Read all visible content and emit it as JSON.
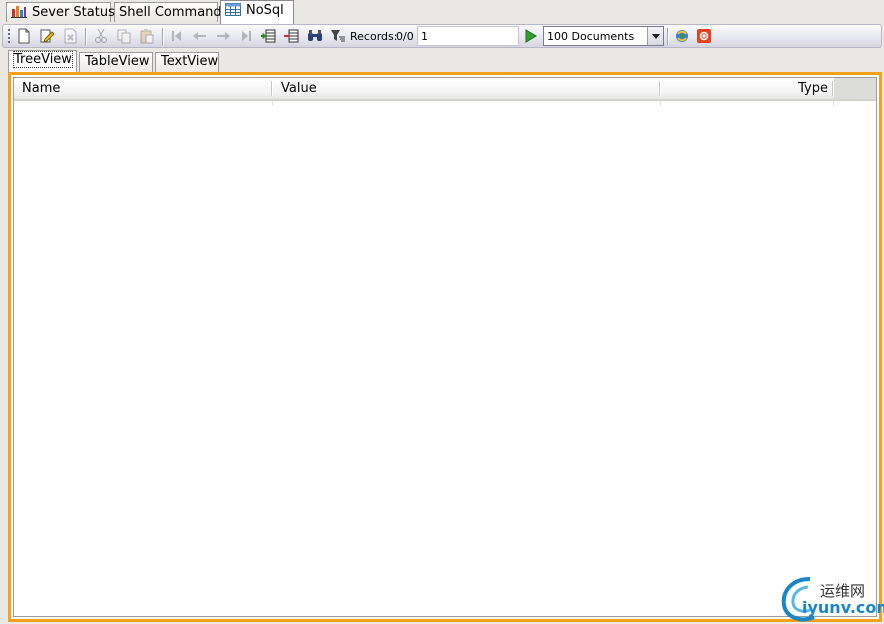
{
  "doc_tabs": [
    {
      "label": "Sever Status",
      "icon": "chart-icon"
    },
    {
      "label": "Shell Command",
      "icon": ""
    },
    {
      "label": "NoSql",
      "icon": "table-icon"
    }
  ],
  "toolbar": {
    "records_label": "Records:",
    "records_value": "0/0",
    "page_input_value": "1",
    "documents_select_value": "100  Documents"
  },
  "view_tabs": [
    {
      "label": "TreeView"
    },
    {
      "label": "TableView"
    },
    {
      "label": "TextView"
    }
  ],
  "grid": {
    "columns": [
      "Name",
      "Value",
      "Type"
    ]
  },
  "watermark": {
    "line1": "运维网",
    "line2": "iyunv.com"
  },
  "colors": {
    "frame_border": "#f5a21a",
    "toolbar_bg": "#e6e6ef"
  }
}
